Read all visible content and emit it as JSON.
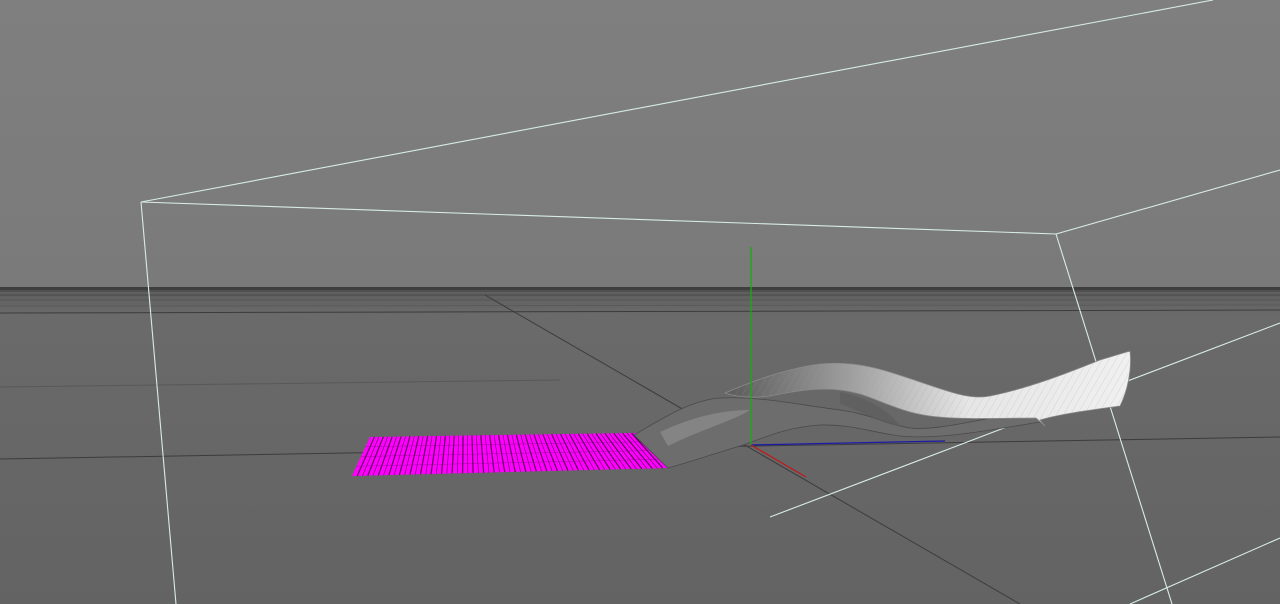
{
  "viewport": {
    "sky_color": "#7f7f7f",
    "floor_color": "#676767",
    "horizon_color": "#3a3a3a",
    "bounding_box_color": "#d8ece6",
    "selected_mesh_color": "#ff00ff",
    "cloth_color": "#e2e2e2",
    "axis_colors": {
      "x": "#c01a1a",
      "y": "#12b012",
      "z": "#1a1aa8"
    },
    "floor_grid": true,
    "selected_object": "magenta-plane-mesh",
    "cloth_object": "twisted-cloth-mesh"
  }
}
